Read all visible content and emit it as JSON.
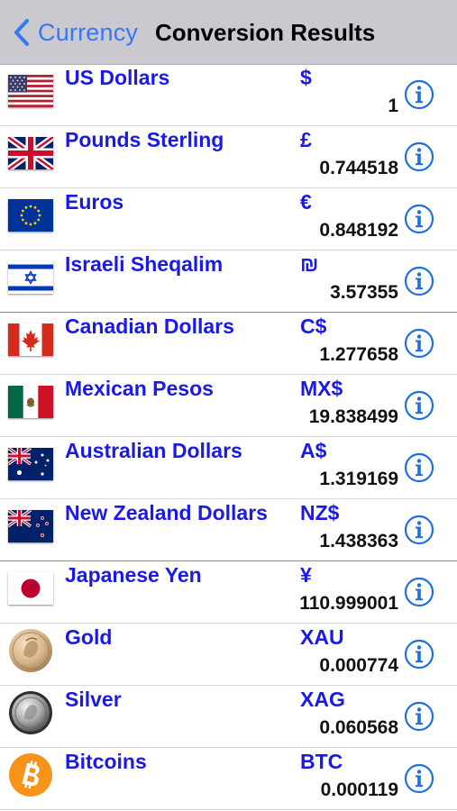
{
  "nav": {
    "back_label": "Currency",
    "title": "Conversion Results"
  },
  "colors": {
    "accent": "#3478f6",
    "name_text": "#1a1ae6",
    "info_icon": "#1f6fe0"
  },
  "rows": [
    {
      "icon": "us-flag-icon",
      "name": "US Dollars",
      "symbol": "$",
      "value": "1"
    },
    {
      "icon": "uk-flag-icon",
      "name": "Pounds Sterling",
      "symbol": "£",
      "value": "0.744518"
    },
    {
      "icon": "eu-flag-icon",
      "name": "Euros",
      "symbol": "€",
      "value": "0.848192"
    },
    {
      "icon": "israel-flag-icon",
      "name": "Israeli Sheqalim",
      "symbol": "₪",
      "value": "3.57355"
    },
    {
      "icon": "canada-flag-icon",
      "name": "Canadian Dollars",
      "symbol": "C$",
      "value": "1.277658"
    },
    {
      "icon": "mexico-flag-icon",
      "name": "Mexican Pesos",
      "symbol": "MX$",
      "value": "19.838499"
    },
    {
      "icon": "australia-flag-icon",
      "name": "Australian Dollars",
      "symbol": "A$",
      "value": "1.319169"
    },
    {
      "icon": "new-zealand-flag-icon",
      "name": "New Zealand Dollars",
      "symbol": "NZ$",
      "value": "1.438363"
    },
    {
      "icon": "japan-flag-icon",
      "name": "Japanese Yen",
      "symbol": "¥",
      "value": "110.999001"
    },
    {
      "icon": "gold-coin-icon",
      "name": "Gold",
      "symbol": "XAU",
      "value": "0.000774"
    },
    {
      "icon": "silver-coin-icon",
      "name": "Silver",
      "symbol": "XAG",
      "value": "0.060568"
    },
    {
      "icon": "bitcoin-icon",
      "name": "Bitcoins",
      "symbol": "BTC",
      "value": "0.000119"
    }
  ]
}
